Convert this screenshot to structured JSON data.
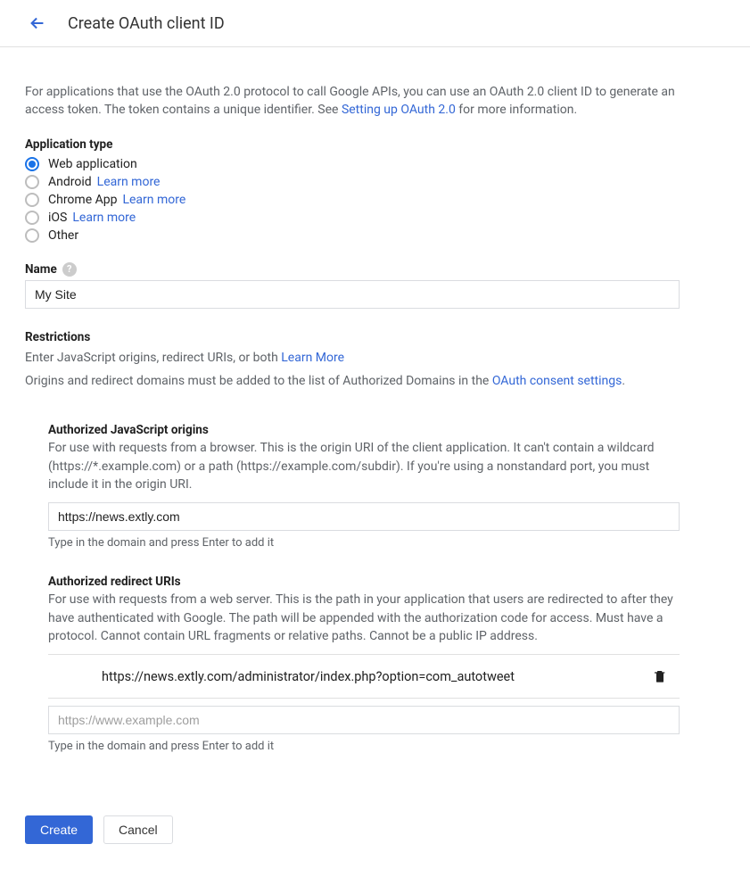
{
  "header": {
    "title": "Create OAuth client ID"
  },
  "intro": {
    "text_before": "For applications that use the OAuth 2.0 protocol to call Google APIs, you can use an OAuth 2.0 client ID to generate an access token. The token contains a unique identifier. See ",
    "link": "Setting up OAuth 2.0",
    "text_after": " for more information."
  },
  "app_type": {
    "label": "Application type",
    "options": [
      {
        "label": "Web application",
        "checked": true,
        "learn_more": null
      },
      {
        "label": "Android",
        "checked": false,
        "learn_more": "Learn more"
      },
      {
        "label": "Chrome App",
        "checked": false,
        "learn_more": "Learn more"
      },
      {
        "label": "iOS",
        "checked": false,
        "learn_more": "Learn more"
      },
      {
        "label": "Other",
        "checked": false,
        "learn_more": null
      }
    ]
  },
  "name": {
    "label": "Name",
    "value": "My Site"
  },
  "restrictions": {
    "label": "Restrictions",
    "desc_before": "Enter JavaScript origins, redirect URIs, or both ",
    "learn_more": "Learn More",
    "domains_before": "Origins and redirect domains must be added to the list of Authorized Domains in the ",
    "domains_link": "OAuth consent settings",
    "domains_after": "."
  },
  "js_origins": {
    "title": "Authorized JavaScript origins",
    "desc": "For use with requests from a browser. This is the origin URI of the client application. It can't contain a wildcard (https://*.example.com) or a path (https://example.com/subdir). If you're using a nonstandard port, you must include it in the origin URI.",
    "value": "https://news.extly.com",
    "hint": "Type in the domain and press Enter to add it"
  },
  "redirect_uris": {
    "title": "Authorized redirect URIs",
    "desc": "For use with requests from a web server. This is the path in your application that users are redirected to after they have authenticated with Google. The path will be appended with the authorization code for access. Must have a protocol. Cannot contain URL fragments or relative paths. Cannot be a public IP address.",
    "entries": [
      "https://news.extly.com/administrator/index.php?option=com_autotweet"
    ],
    "placeholder": "https://www.example.com",
    "hint": "Type in the domain and press Enter to add it"
  },
  "actions": {
    "create": "Create",
    "cancel": "Cancel"
  }
}
